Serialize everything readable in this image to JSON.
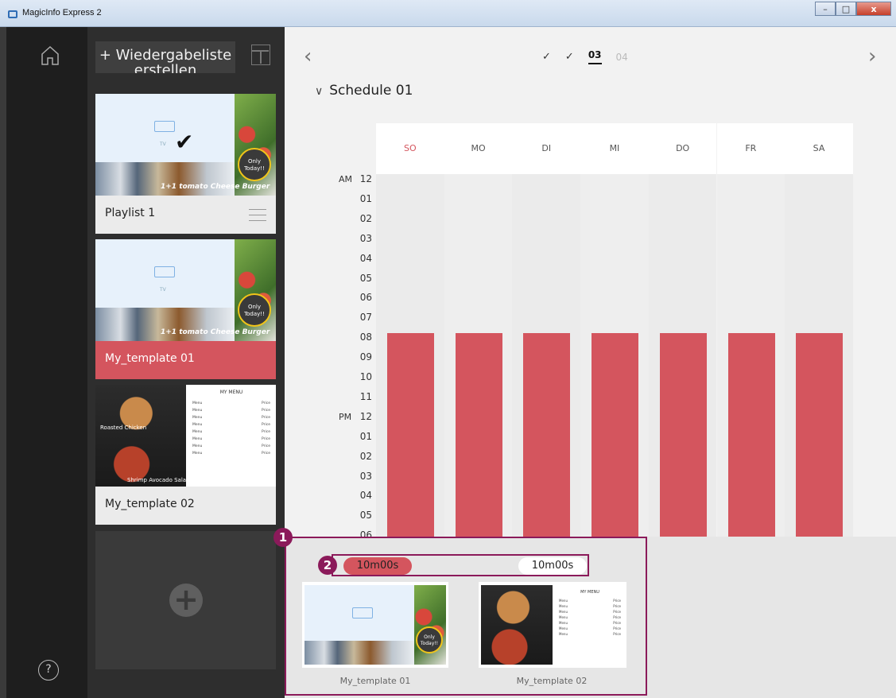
{
  "window": {
    "title": "MagicInfo Express 2",
    "min": "–",
    "max": "□",
    "close": "x"
  },
  "sidebar": {
    "help": "?"
  },
  "playlist_panel": {
    "create_button": "+ Wiedergabeliste erstellen",
    "cards": [
      {
        "label": "Playlist 1",
        "photo_text": "1+1 tomato Cheese Burger",
        "badge": "Only Today!!",
        "tv_text": "TV"
      },
      {
        "label": "My_template 01",
        "photo_text": "1+1 tomato Cheese Burger",
        "badge": "Only Today!!",
        "tv_text": "TV"
      },
      {
        "label": "My_template 02",
        "food1": "Roasted Chicken",
        "food2": "Shrimp Avocado Salad",
        "menu_title": "MY MENU",
        "menu_rows": [
          [
            "Menu",
            "Price"
          ],
          [
            "Menu",
            "Price"
          ],
          [
            "Menu",
            "Price"
          ],
          [
            "Menu",
            "Price"
          ],
          [
            "Menu",
            "Price"
          ],
          [
            "Menu",
            "Price"
          ],
          [
            "Menu",
            "Price"
          ],
          [
            "Menu",
            "Price"
          ]
        ]
      }
    ],
    "add": "+"
  },
  "main": {
    "steps": [
      "✓",
      "✓",
      "03",
      "04"
    ],
    "schedule_title": "Schedule 01",
    "days": [
      "SO",
      "MO",
      "DI",
      "MI",
      "DO",
      "FR",
      "SA"
    ],
    "hours": [
      "12",
      "01",
      "02",
      "03",
      "04",
      "05",
      "06",
      "07",
      "08",
      "09",
      "10",
      "11",
      "12",
      "01",
      "02",
      "03",
      "04",
      "05",
      "06"
    ],
    "am": "AM",
    "pm": "PM"
  },
  "bottom": {
    "marker1": "1",
    "marker2": "2",
    "duration_left": "10m00s",
    "duration_right": "10m00s",
    "thumb1_label": "My_template 01",
    "thumb2_label": "My_template 02"
  },
  "colors": {
    "accent": "#d4555e",
    "highlight": "#8b1a5a"
  }
}
